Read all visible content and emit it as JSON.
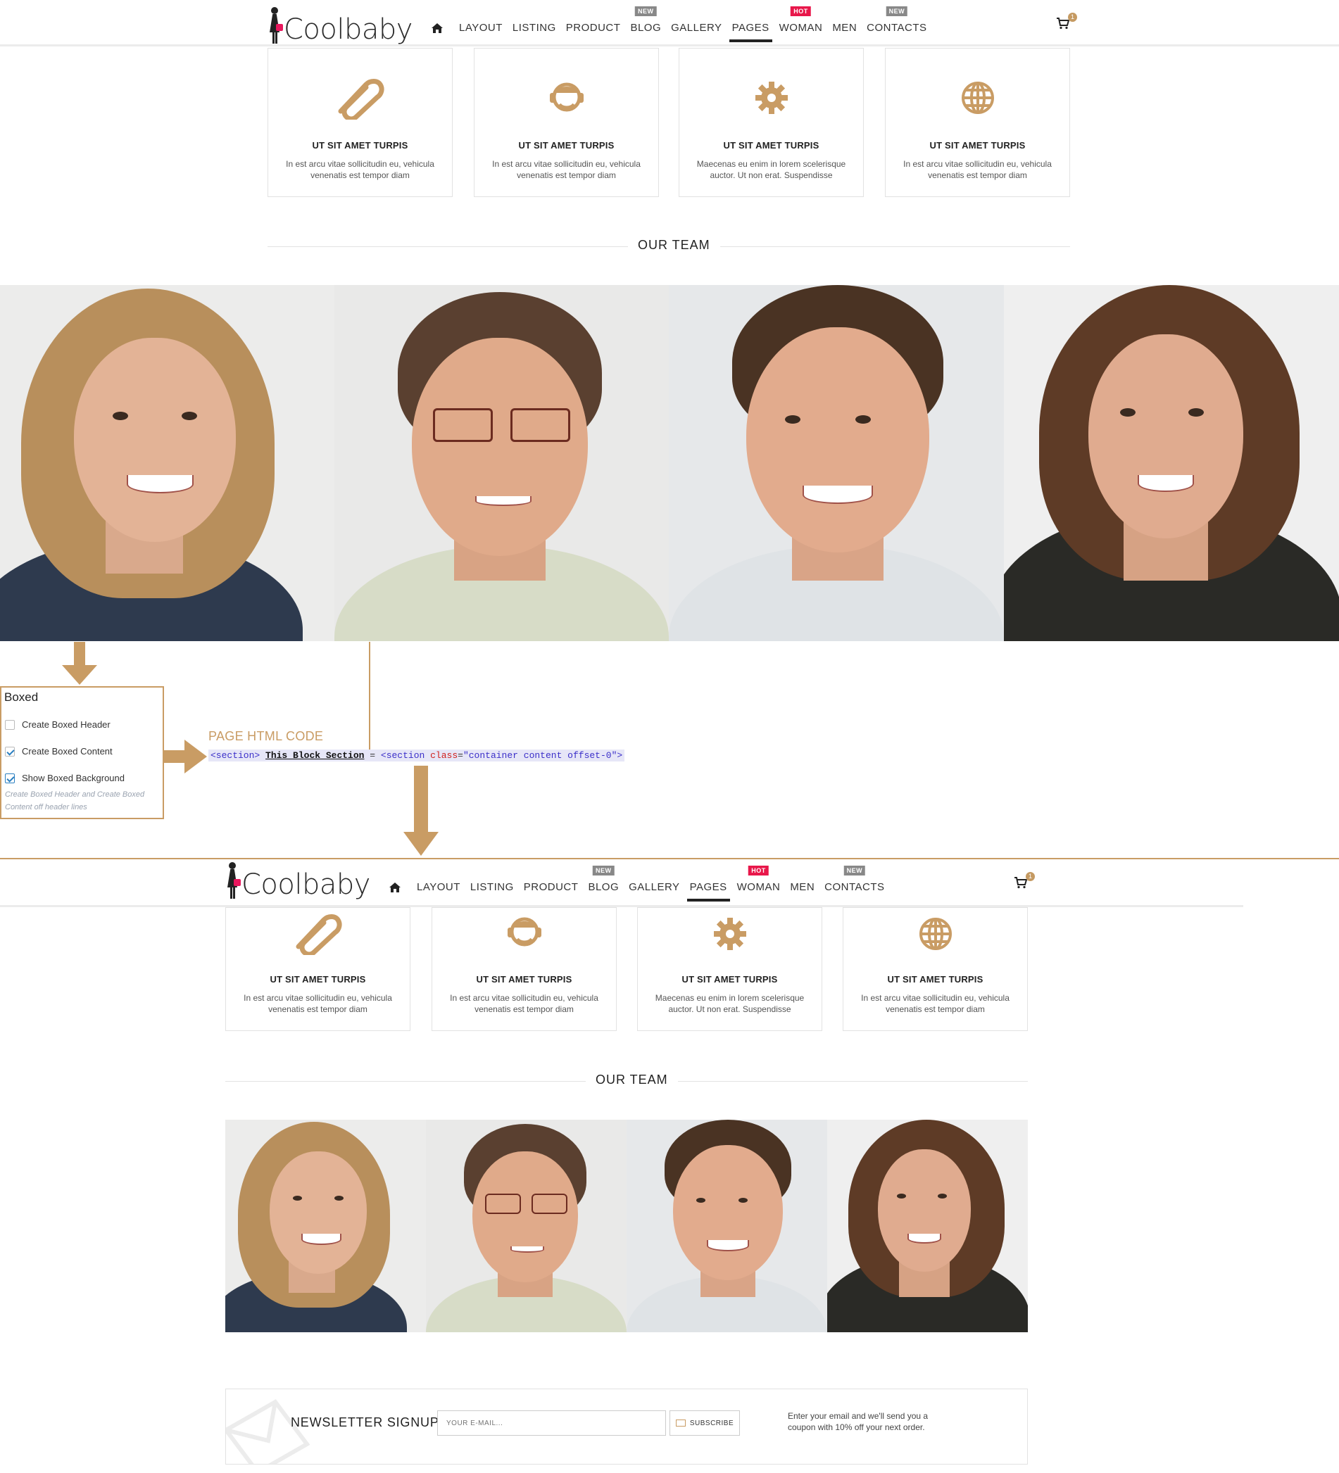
{
  "header": {
    "logo": "Coolbaby",
    "nav": [
      {
        "label": "LAYOUT"
      },
      {
        "label": "LISTING"
      },
      {
        "label": "PRODUCT"
      },
      {
        "label": "BLOG",
        "badge": "NEW"
      },
      {
        "label": "GALLERY"
      },
      {
        "label": "PAGES",
        "active": true
      },
      {
        "label": "WOMAN",
        "badge": "HOT"
      },
      {
        "label": "MEN"
      },
      {
        "label": "CONTACTS",
        "badge": "NEW"
      }
    ],
    "cart_count": "1"
  },
  "features": [
    {
      "icon": "paperclip-icon",
      "title": "UT SIT AMET TURPIS",
      "line1": "In est arcu vitae sollicitudin eu, vehicula",
      "line2": "venenatis est tempor diam"
    },
    {
      "icon": "headset-icon",
      "title": "UT SIT AMET TURPIS",
      "line1": "In est arcu vitae sollicitudin eu, vehicula",
      "line2": "venenatis est tempor diam"
    },
    {
      "icon": "gear-icon",
      "title": "UT SIT AMET TURPIS",
      "line1": "Maecenas eu enim in lorem scelerisque",
      "line2": "auctor. Ut non erat. Suspendisse"
    },
    {
      "icon": "globe-icon",
      "title": "UT SIT AMET TURPIS",
      "line1": "In est arcu vitae sollicitudin eu, vehicula",
      "line2": "venenatis est tempor diam"
    }
  ],
  "team": {
    "title": "OUR TEAM"
  },
  "boxed": {
    "title": "Boxed",
    "options": [
      {
        "label": "Create Boxed Header",
        "checked": false
      },
      {
        "label": "Create Boxed Content",
        "checked": true
      },
      {
        "label": "Show Boxed Background",
        "checked": true
      }
    ],
    "hint_line1": "Create Boxed Header and Create Boxed",
    "hint_line2": "Content off header lines"
  },
  "code": {
    "label": "PAGE HTML CODE",
    "tag_open": "<section>",
    "block_text": "This Block Section",
    "equals": "=",
    "tag_start": "<section ",
    "attr": "class",
    "attr_eq": "=",
    "attr_value": "\"container content offset-0\">"
  },
  "newsletter": {
    "title": "NEWSLETTER SIGNUP",
    "placeholder": "YOUR E-MAIL...",
    "button": "SUBSCRIBE",
    "note_line1": "Enter your email and we'll send you a",
    "note_line2": "coupon with 10% off your next order."
  },
  "colors": {
    "accent": "#c99c64",
    "hot": "#e8174a",
    "new": "#888888"
  }
}
